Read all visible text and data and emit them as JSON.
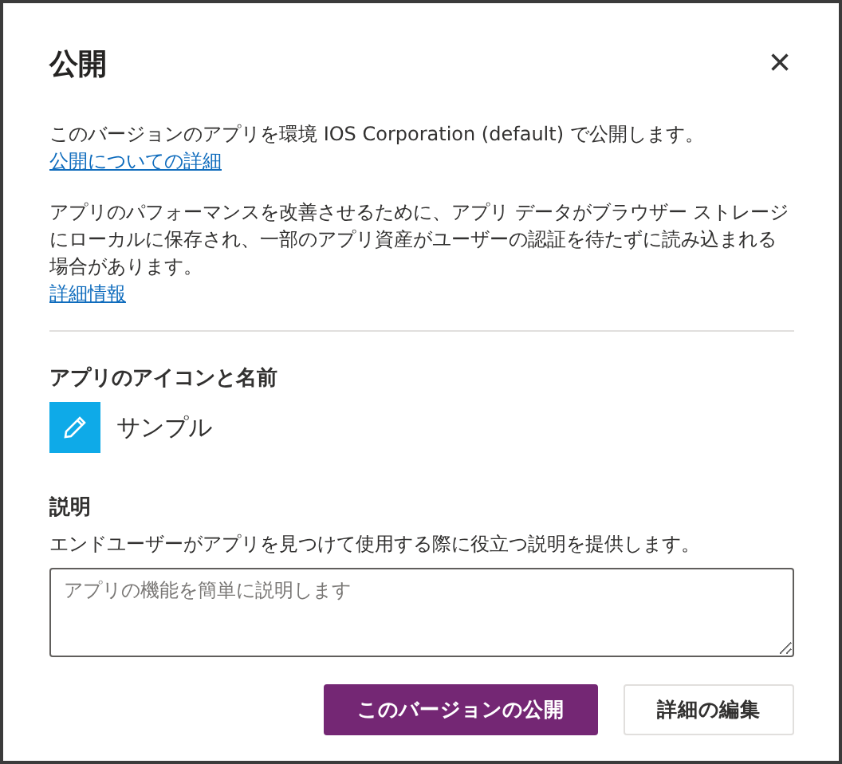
{
  "dialog": {
    "title": "公開",
    "close_label": "×"
  },
  "intro": {
    "text": "このバージョンのアプリを環境 IOS Corporation (default) で公開します。",
    "link": "公開についての詳細"
  },
  "cache_note": {
    "text": "アプリのパフォーマンスを改善させるために、アプリ データがブラウザー ストレージにローカルに保存され、一部のアプリ資産がユーザーの認証を待たずに読み込まれる場合があります。",
    "link": "詳細情報"
  },
  "app_identity": {
    "heading": "アプリのアイコンと名前",
    "name": "サンプル"
  },
  "description": {
    "heading": "説明",
    "help": "エンドユーザーがアプリを見つけて使用する際に役立つ説明を提供します。",
    "placeholder": "アプリの機能を簡単に説明します"
  },
  "buttons": [
    {
      "label": "このバージョンの公開",
      "kind": "primary"
    },
    {
      "label": "詳細の編集",
      "kind": "secondary"
    }
  ]
}
